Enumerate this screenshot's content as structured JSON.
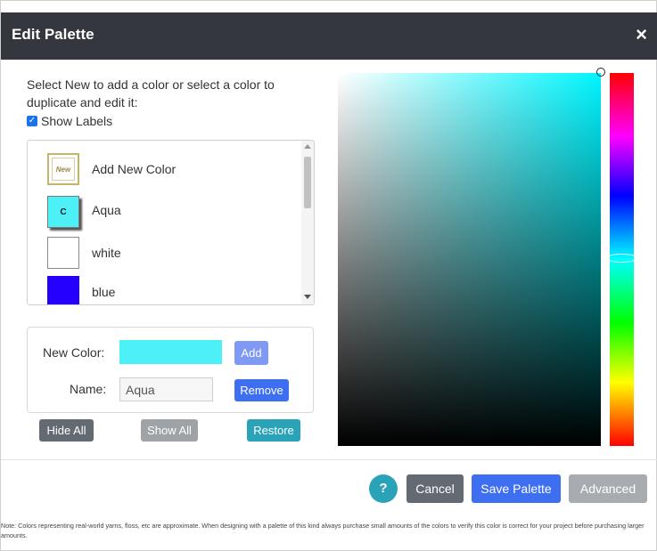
{
  "dialog": {
    "title": "Edit Palette",
    "close_symbol": "×"
  },
  "instructions": "Select New to add a color or select a color to duplicate and edit it:",
  "show_labels": {
    "label": "Show Labels",
    "checked": true,
    "check_symbol": "✓"
  },
  "color_list": [
    {
      "label": "Add New Color",
      "swatch_text": "New",
      "color": "#ffffff"
    },
    {
      "label": "Aqua",
      "swatch_text": "C",
      "color": "#4ef0f7",
      "selected": true
    },
    {
      "label": "white",
      "swatch_text": "",
      "color": "#ffffff"
    },
    {
      "label": "blue",
      "swatch_text": "",
      "color": "#2600ff"
    }
  ],
  "edit": {
    "new_color_label": "New Color:",
    "new_color_value": "#4ef0f7",
    "add_label": "Add",
    "name_label": "Name:",
    "name_value": "Aqua",
    "remove_label": "Remove"
  },
  "list_actions": {
    "hide_all": "Hide All",
    "show_all": "Show All",
    "restore": "Restore"
  },
  "footer": {
    "help_label": "?",
    "cancel_label": "Cancel",
    "save_label": "Save Palette",
    "advanced_label": "Advanced"
  },
  "note": "Note: Colors representing real-world yarns, floss, etc are approximate. When designing with a palette of this kind always purchase small amounts of the colors to verify this color is correct for your project before purchasing larger amounts.",
  "colors": {
    "header_bg": "#34383e",
    "primary": "#3d6ff0",
    "info": "#2aa3b9",
    "secondary": "#636a72"
  }
}
